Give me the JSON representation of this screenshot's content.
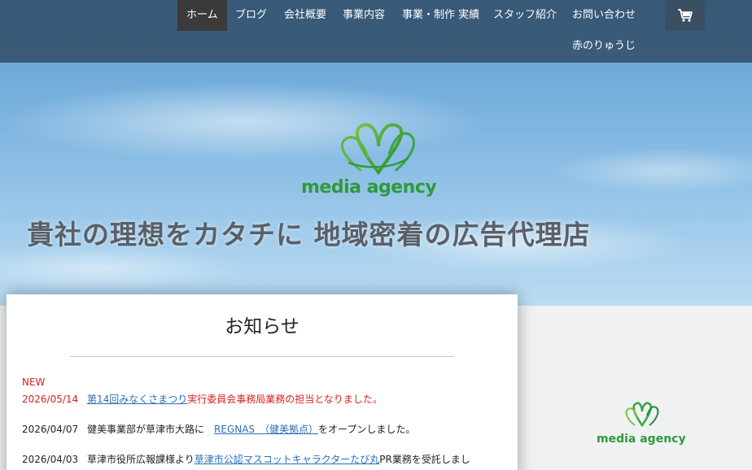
{
  "nav": {
    "items": [
      "ホーム",
      "ブログ",
      "会社概要",
      "事業内容",
      "事業・制作 実績",
      "スタッフ紹介",
      "お問い合わせ"
    ],
    "second_row": "赤のりゅうじ",
    "cart_icon": "cart-icon"
  },
  "hero": {
    "logo_text": "media agency",
    "tagline": "貴社の理想をカタチに 地域密着の広告代理店"
  },
  "notice": {
    "title": "お知らせ",
    "new_label": "NEW",
    "items": [
      {
        "date": "2026/05/14",
        "link": "第14回みなくさまつり",
        "text": "実行委員会事務局業務の担当となりました。"
      },
      {
        "date": "2026/04/07",
        "pre": "健美事業部が草津市大路に",
        "link": "REGNAS　（健美拠点）",
        "text": "をオープンしました。"
      },
      {
        "date": "2026/04/03",
        "pre": "草津市役所広報課様より",
        "link": "草津市公認マスコットキャラクターたび丸",
        "text": "PR業務を受託しまし"
      }
    ]
  },
  "side": {
    "logo_text": "media agency"
  },
  "colors": {
    "brand_green": "#2f9a3c",
    "news_red": "#d62020",
    "link_blue": "#2b6fb6"
  }
}
